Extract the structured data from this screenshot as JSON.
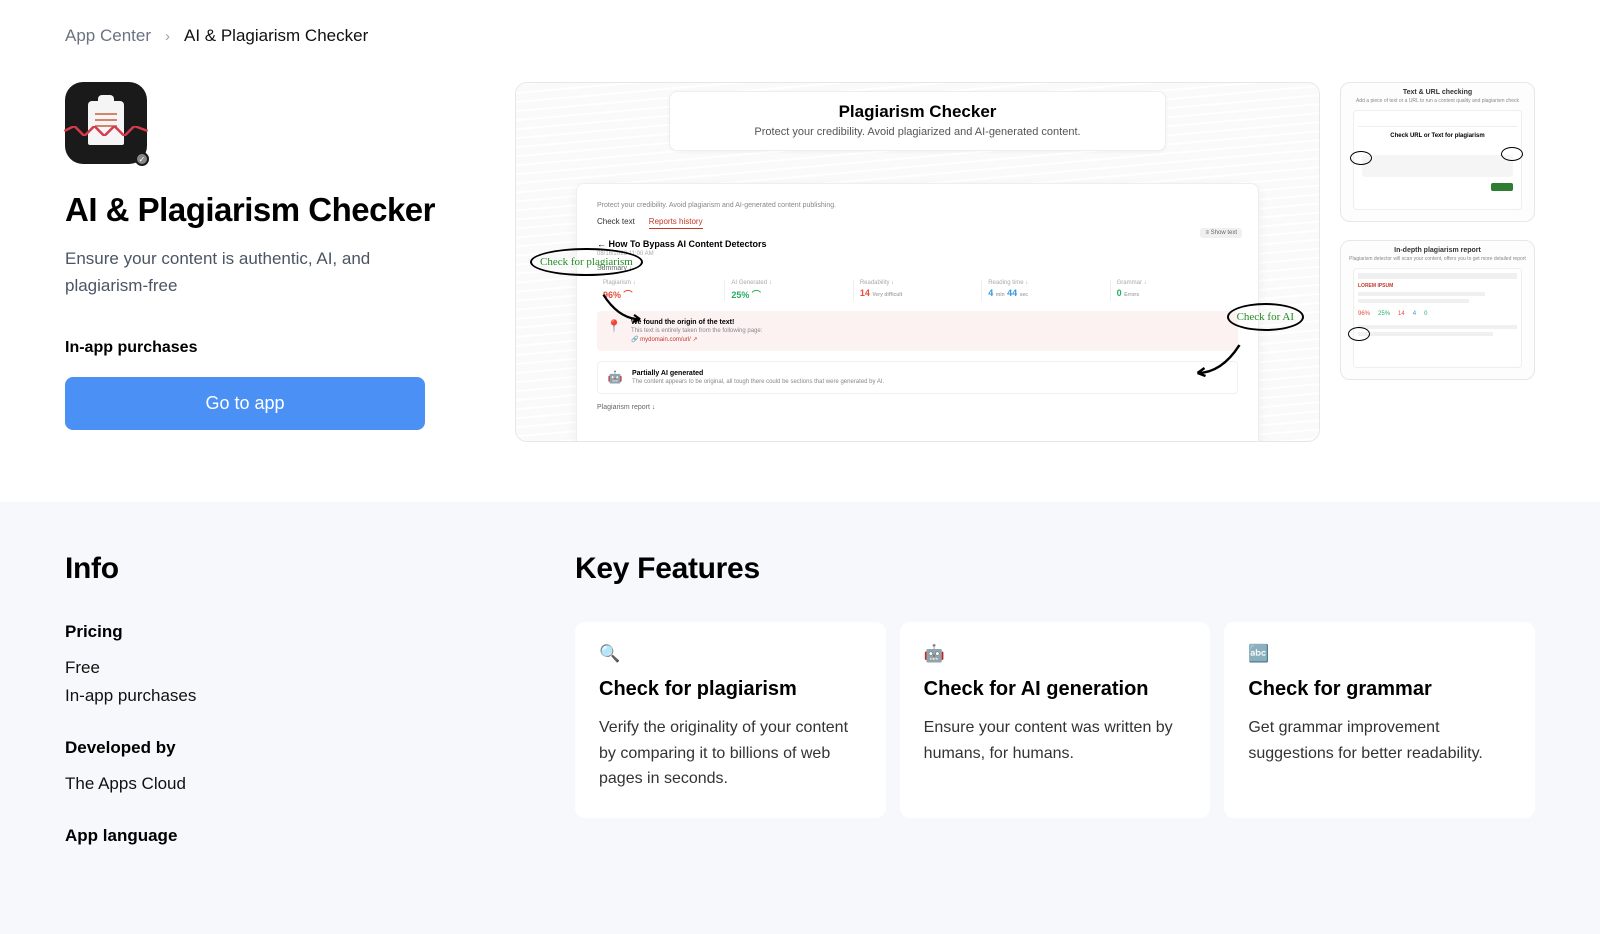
{
  "breadcrumb": {
    "home": "App Center",
    "current": "AI & Plagiarism Checker"
  },
  "app": {
    "title": "AI & Plagiarism Checker",
    "subtitle": "Ensure your content is authentic, AI, and plagiarism-free",
    "iap_label": "In-app purchases",
    "cta": "Go to app"
  },
  "hero": {
    "title": "Plagiarism Checker",
    "subtitle": "Protect your credibility. Avoid plagiarized and AI-generated content.",
    "intro": "Protect your credibility. Avoid plagiarism and AI-generated content publishing.",
    "tab1": "Check text",
    "tab2": "Reports history",
    "article_title": "← How To Bypass AI Content Detectors",
    "article_date": "08/16/2023 11:00 AM",
    "show_btn": "≡ Show text",
    "summary_label": "Summary ↓",
    "metrics": {
      "plag_l": "Plagiarism ↓",
      "plag_v": "96% ⌒",
      "ai_l": "AI Generated ↓",
      "ai_v": "25% ⌒",
      "read_l": "Readability ↓",
      "read_v": "14",
      "read_s": "Very difficult",
      "time_l": "Reading time ↓",
      "time_m": "4",
      "time_ms": "min",
      "time_s": "44",
      "time_ss": "sec",
      "gram_l": "Grammar ↓",
      "gram_v": "0",
      "gram_s": "Errors"
    },
    "find1_t": "We found the origin of the text!",
    "find1_d": "This text is entirely taken from the following page:",
    "find1_link": "🔗 mydomain.com/url/ ↗",
    "find2_t": "Partially AI generated",
    "find2_d": "The content appears to be original, all tough there could be sections that were generated by AI.",
    "report_label": "Plagiarism report ↓",
    "annot_left": "Check for plagiarism",
    "annot_right": "Check for AI"
  },
  "thumbs": {
    "t1_title": "Text & URL checking",
    "t1_sub": "Add a piece of text or a URL to run a content quality and plagiarism check",
    "t1_h": "Check URL or Text for plagiarism",
    "t2_title": "In-depth plagiarism report",
    "t2_sub": "Plagiarism detector will scan your content, offers you to get more detailed report"
  },
  "info": {
    "title": "Info",
    "pricing_h": "Pricing",
    "pricing_1": "Free",
    "pricing_2": "In-app purchases",
    "dev_h": "Developed by",
    "dev_v": "The Apps Cloud",
    "lang_h": "App language"
  },
  "features": {
    "title": "Key Features",
    "cards": [
      {
        "icon": "🔍",
        "title": "Check for plagiarism",
        "desc": "Verify the originality of your content by comparing it to billions of web pages in seconds."
      },
      {
        "icon": "🤖",
        "title": "Check for AI generation",
        "desc": "Ensure your content was written by humans, for humans."
      },
      {
        "icon": "🔤",
        "title": "Check for grammar",
        "desc": "Get grammar improvement suggestions for better readability."
      }
    ]
  }
}
